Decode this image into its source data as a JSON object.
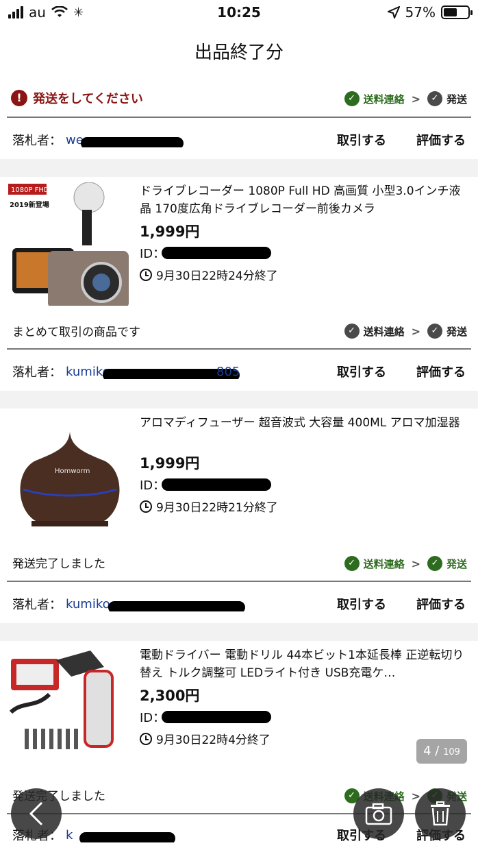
{
  "status_bar": {
    "carrier": "au",
    "time": "10:25",
    "battery": "57%"
  },
  "page": {
    "title": "出品終了分"
  },
  "notice": {
    "text": "発送をしてください",
    "icon": "alert-icon"
  },
  "steps": {
    "shipping_contact": "送料連絡",
    "ship": "発送",
    "arrow": ">"
  },
  "labels": {
    "winner": "落札者：",
    "trade": "取引する",
    "rate": "評価する",
    "id_prefix": "ID："
  },
  "top_winner": {
    "id_visible": "we"
  },
  "items": [
    {
      "title": "ドライブレコーダー 1080P Full HD 高画質 小型3.0インチ液晶 170度広角ドライブレコーダー前後カメラ",
      "price": "1,999円",
      "end_time": "9月30日22時24分終了",
      "thumb_badge": "1080P FHD",
      "thumb_caption": "2019新登場",
      "status": "まとめて取引の商品です",
      "steps_state": [
        "gray",
        "gray"
      ],
      "winner_id_visible": "kumiko",
      "winner_id_tail": "805"
    },
    {
      "title": "アロマディフューザー 超音波式 大容量 400ML アロマ加湿器",
      "price": "1,999円",
      "end_time": "9月30日22時21分終了",
      "thumb_brand": "Homworm",
      "status": "発送完了しました",
      "steps_state": [
        "green",
        "green"
      ],
      "winner_id_visible": "kumiko"
    },
    {
      "title": "電動ドライバー 電動ドリル 44本ビット1本延長棒 正逆転切り替え トルク調整可 LEDライト付き USB充電ケ…",
      "price": "2,300円",
      "end_time": "9月30日22時4分終了",
      "status": "発送完了しました",
      "steps_state": [
        "green",
        "green"
      ],
      "winner_id_visible": "k"
    }
  ],
  "pager": {
    "current": "4",
    "separator": "/",
    "total": "109"
  },
  "fab": {
    "back": "back-icon",
    "camera": "camera-icon",
    "trash": "trash-icon"
  },
  "colors": {
    "alert": "#8b1414",
    "done_green": "#2d6b1f",
    "link_blue": "#1a3d8f",
    "step_gray": "#4a4a4a"
  }
}
